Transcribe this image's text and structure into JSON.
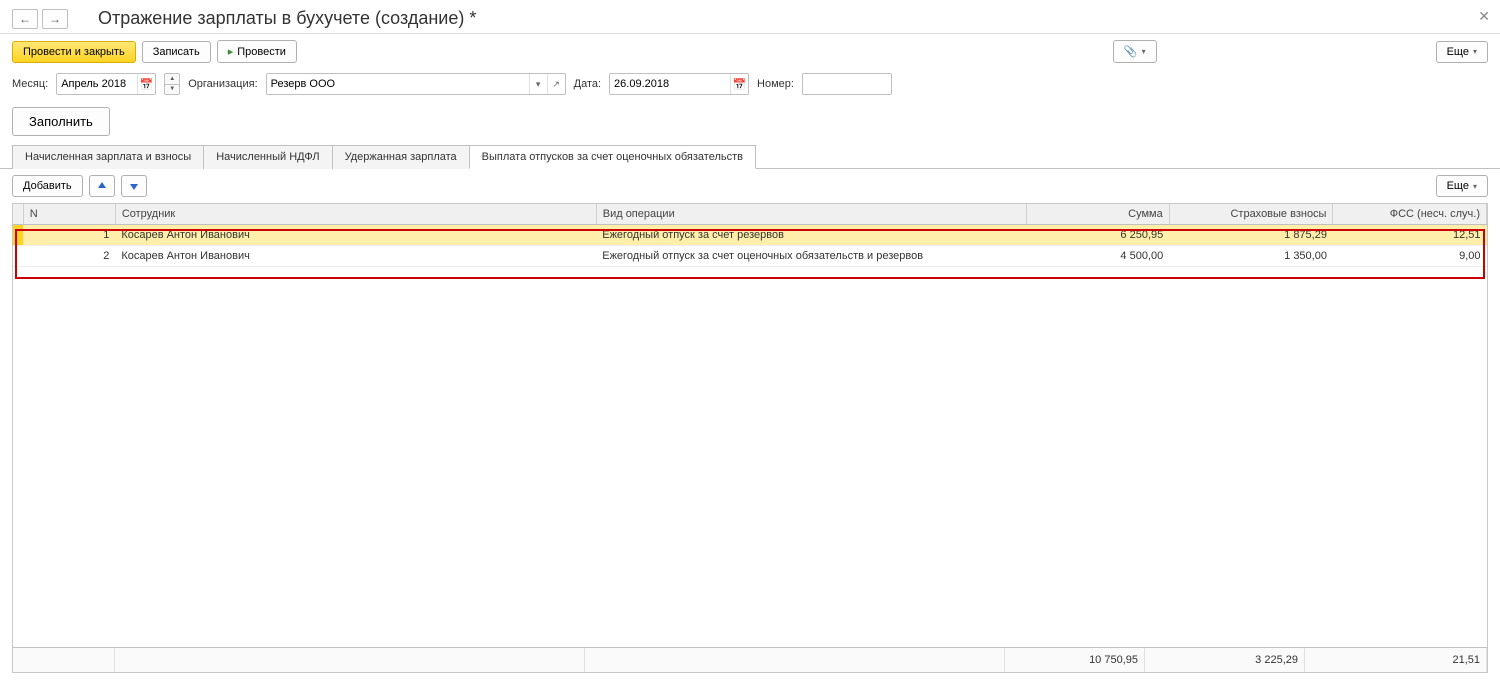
{
  "titlebar": {
    "title": "Отражение зарплаты в бухучете (создание) *"
  },
  "toolbar": {
    "save_close_label": "Провести и закрыть",
    "write_label": "Записать",
    "post_label": "Провести",
    "more_label": "Еще"
  },
  "form": {
    "month_label": "Месяц:",
    "month_value": "Апрель 2018",
    "org_label": "Организация:",
    "org_value": "Резерв ООО",
    "date_label": "Дата:",
    "date_value": "26.09.2018",
    "number_label": "Номер:",
    "number_value": "",
    "fill_label": "Заполнить"
  },
  "tabs": {
    "t1": "Начисленная зарплата и взносы",
    "t2": "Начисленный НДФЛ",
    "t3": "Удержанная зарплата",
    "t4": "Выплата отпусков за счет оценочных обязательств"
  },
  "subtoolbar": {
    "add_label": "Добавить",
    "more_label": "Еще"
  },
  "table": {
    "headers": {
      "n": "N",
      "employee": "Сотрудник",
      "operation": "Вид операции",
      "sum": "Сумма",
      "insurance": "Страховые взносы",
      "fss": "ФСС (несч. случ.)"
    },
    "rows": [
      {
        "n": "1",
        "employee": "Косарев Антон Иванович",
        "operation": "Ежегодный отпуск за счет резервов",
        "sum": "6 250,95",
        "insurance": "1 875,29",
        "fss": "12,51",
        "selected": true
      },
      {
        "n": "2",
        "employee": "Косарев Антон Иванович",
        "operation": "Ежегодный отпуск за счет оценочных обязательств и резервов",
        "sum": "4 500,00",
        "insurance": "1 350,00",
        "fss": "9,00",
        "selected": false
      }
    ],
    "totals": {
      "sum": "10 750,95",
      "insurance": "3 225,29",
      "fss": "21,51"
    }
  }
}
